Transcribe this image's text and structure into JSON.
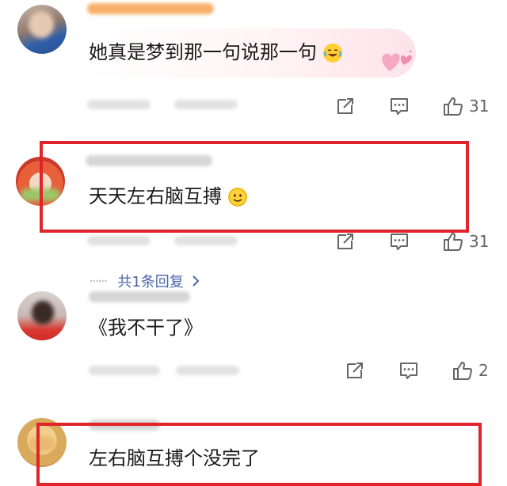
{
  "comments": [
    {
      "text": "她真是梦到那一句说那一句",
      "emoji": "laughing-tears-emoji",
      "likes": "31"
    },
    {
      "text": "天天左右脑互搏",
      "emoji": "smile-emoji",
      "likes": "31",
      "replies_label": "共1条回复",
      "replies_dots": "······"
    },
    {
      "text": "《我不干了》",
      "likes": "2"
    },
    {
      "text": "左右脑互搏个没完了"
    }
  ],
  "colors": {
    "highlight": "#e0242b",
    "reply_link": "#4a66a8",
    "icon": "#666666"
  }
}
